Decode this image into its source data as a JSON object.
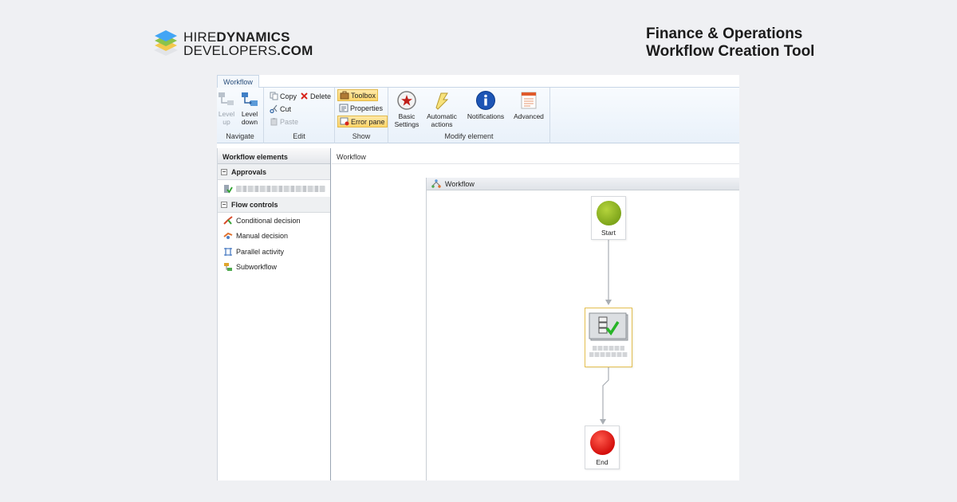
{
  "brand": {
    "name_thin": "HIRE",
    "name_bold": "DYNAMICS",
    "sub_thin": "DEVELOPERS",
    "sub_bold": ".COM"
  },
  "headline": {
    "line1": "Finance & Operations",
    "line2": "Workflow Creation Tool"
  },
  "colors": {
    "accent_green": "#8ab31f",
    "accent_red": "#e01b14",
    "selected_border": "#e4bf4f",
    "ribbon_active": "#ffd66b"
  },
  "app": {
    "tab": "Workflow",
    "ribbon": {
      "navigate": {
        "label": "Navigate",
        "level_up": "Level up",
        "level_up_l1": "Level",
        "level_up_l2": "up",
        "level_down_l1": "Level",
        "level_down_l2": "down"
      },
      "edit": {
        "label": "Edit",
        "copy": "Copy",
        "delete": "Delete",
        "cut": "Cut",
        "paste": "Paste"
      },
      "show": {
        "label": "Show",
        "toolbox": "Toolbox",
        "properties": "Properties",
        "error_pane": "Error pane"
      },
      "modify": {
        "label": "Modify element",
        "basic_l1": "Basic",
        "basic_l2": "Settings",
        "auto_l1": "Automatic",
        "auto_l2": "actions",
        "notifications": "Notifications",
        "advanced": "Advanced"
      }
    },
    "left_pane": {
      "title": "Workflow elements",
      "approvals": {
        "title": "Approvals",
        "expander": "⊟"
      },
      "flow_controls": {
        "title": "Flow controls",
        "expander": "⊟",
        "items": [
          "Conditional decision",
          "Manual decision",
          "Parallel activity",
          "Subworkflow"
        ]
      }
    },
    "canvas": {
      "breadcrumb": "Workflow",
      "panel_title": "Workflow",
      "start_label": "Start",
      "end_label": "End"
    }
  }
}
